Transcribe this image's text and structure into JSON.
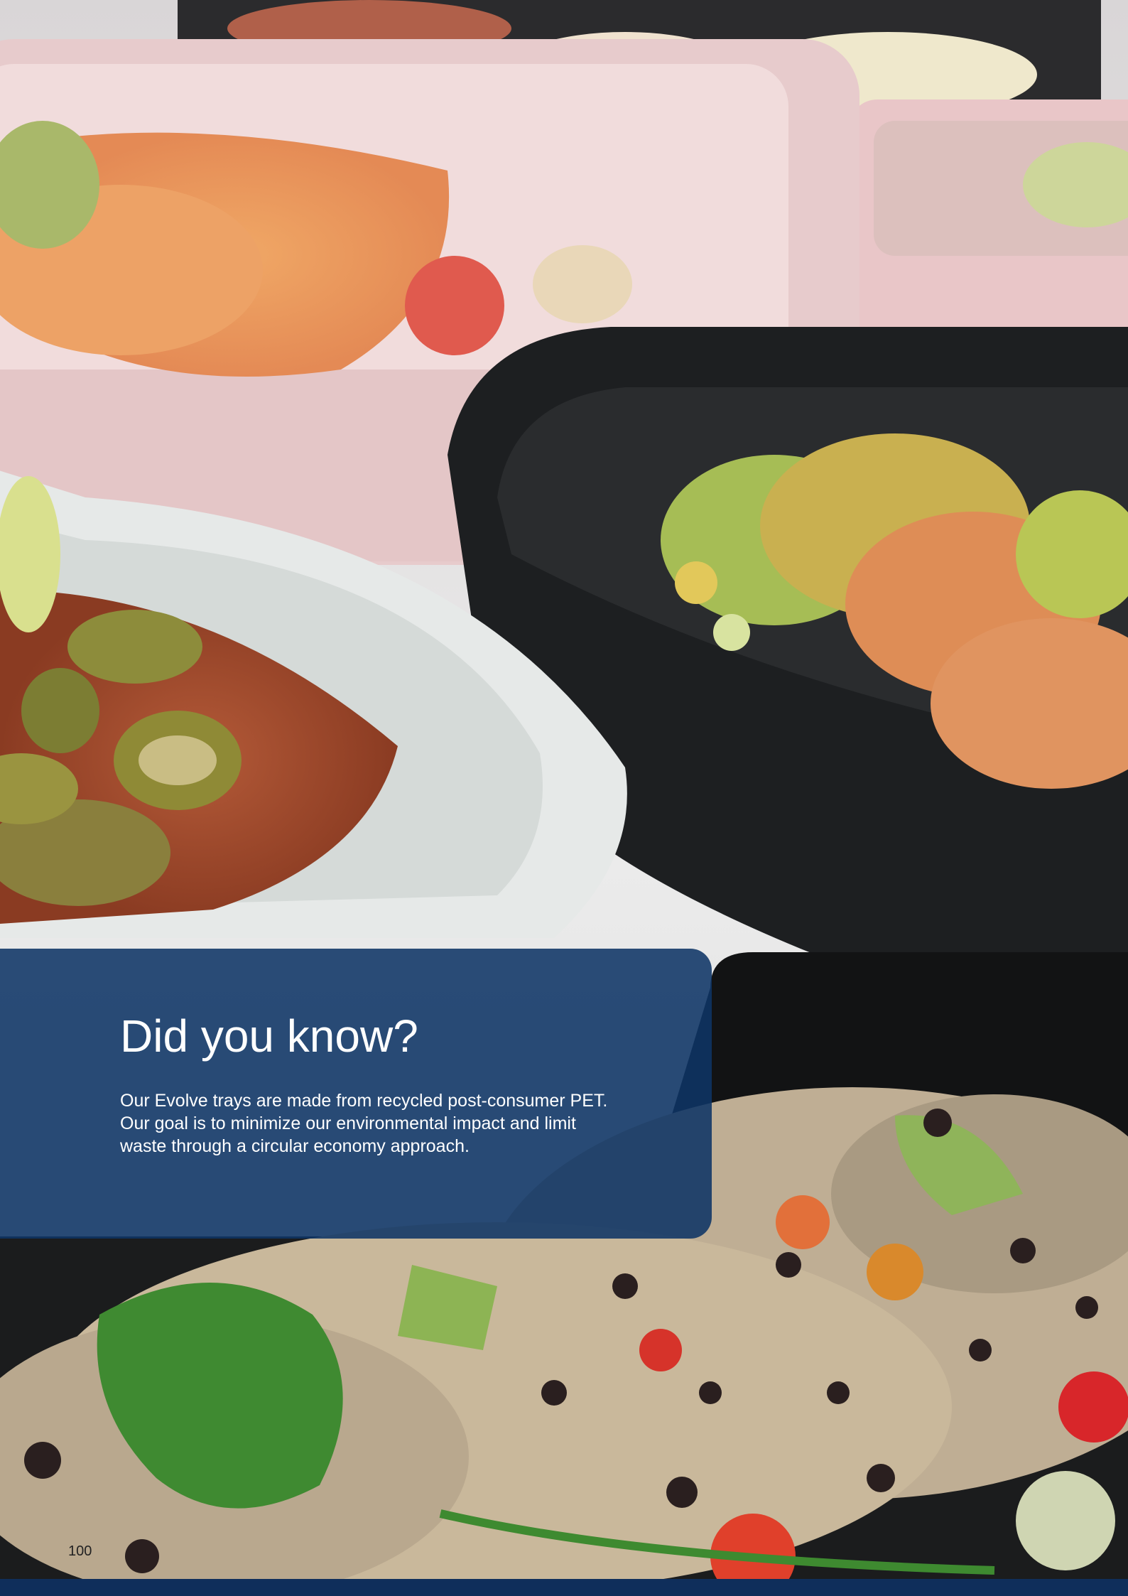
{
  "info_box": {
    "title": "Did you know?",
    "body": "Our Evolve trays are made from recycled post-consumer PET. Our goal is to minimize our environmental impact and limit waste through a circular economy approach."
  },
  "page_number": "100",
  "colors": {
    "panel": "#0e3465",
    "footer_bar": "#0f2e5b",
    "text_on_panel": "#ffffff"
  }
}
